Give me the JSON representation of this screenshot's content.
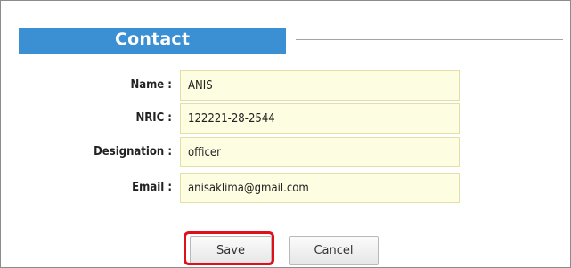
{
  "section": {
    "title": "Contact"
  },
  "form": {
    "fields": [
      {
        "label": "Name :",
        "value": "ANIS"
      },
      {
        "label": "NRIC :",
        "value": "122221-28-2544"
      },
      {
        "label": "Designation :",
        "value": "officer"
      },
      {
        "label": "Email :",
        "value": "anisaklima@gmail.com"
      }
    ]
  },
  "actions": {
    "save_label": "Save",
    "cancel_label": "Cancel"
  },
  "colors": {
    "header_bg": "#3b8fd3",
    "input_bg": "#fdfde1",
    "highlight": "#e0101a"
  }
}
